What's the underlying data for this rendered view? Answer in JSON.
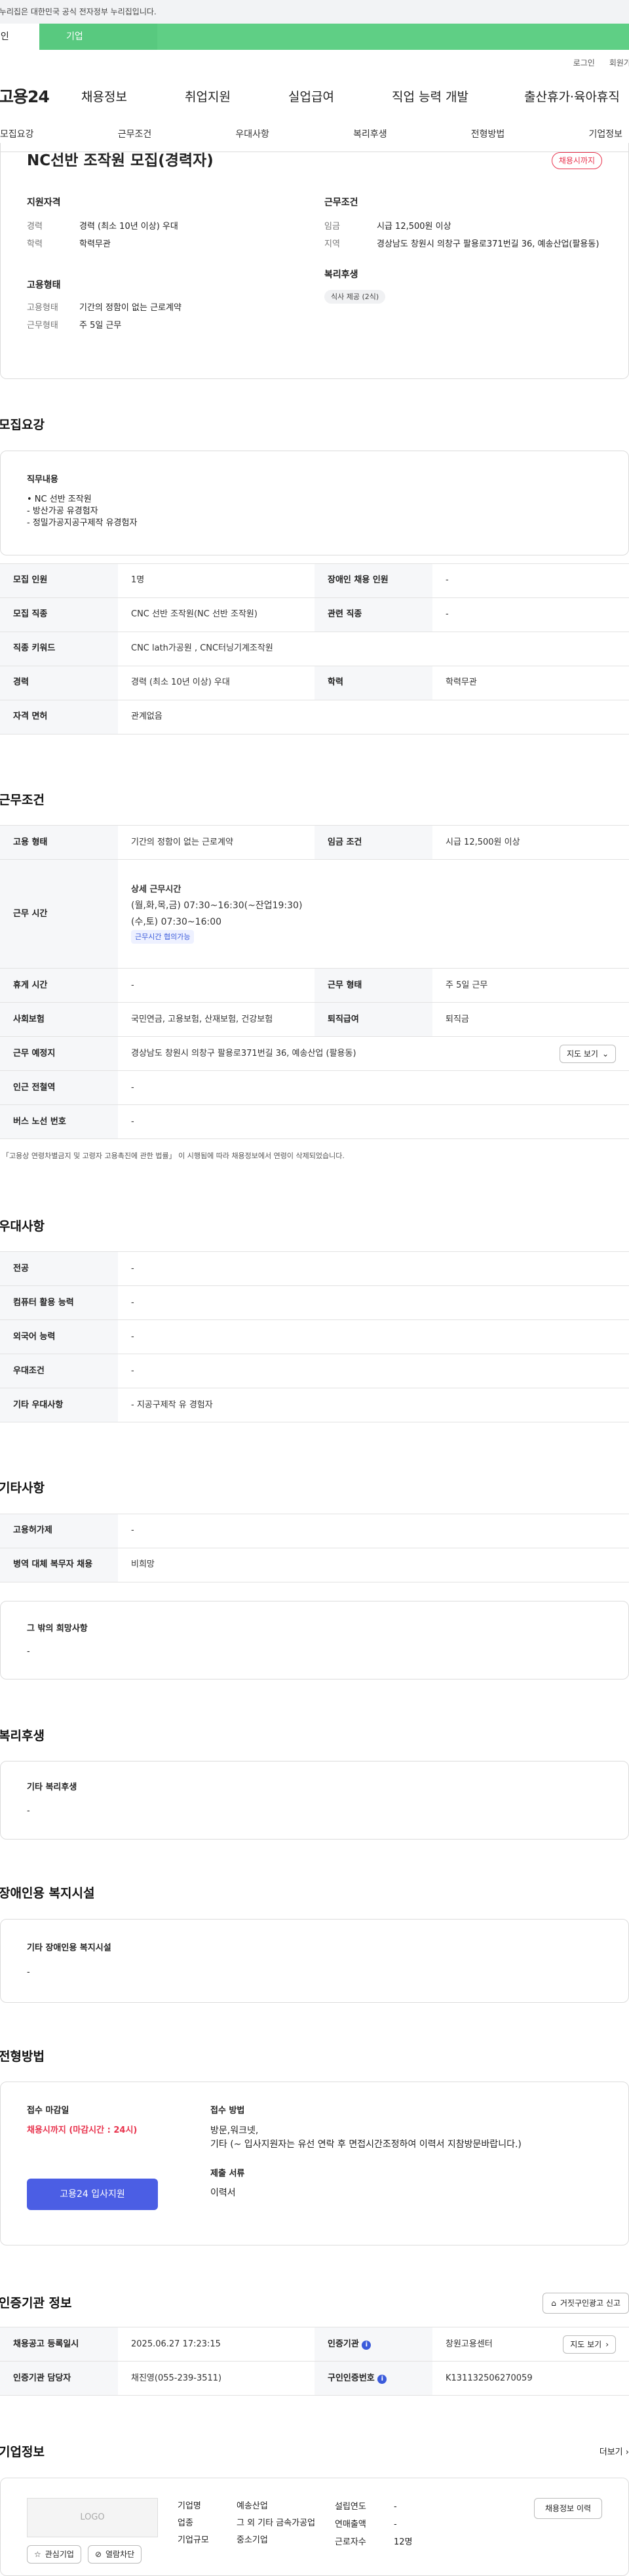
{
  "gov_banner": "이 누리집은 대한민국 공식 전자정부 누리집입니다.",
  "tabs": {
    "personal": "개인",
    "biz": "기업"
  },
  "util": {
    "login": "로그인",
    "join": "회원가입"
  },
  "gnb": {
    "logo": "고용24",
    "items": [
      "채용정보",
      "취업지원",
      "실업급여",
      "직업 능력 개발",
      "출산휴가·육아휴직"
    ]
  },
  "lnb": [
    "모집요강",
    "근무조건",
    "우대사항",
    "복리후생",
    "전형방법",
    "기업정보"
  ],
  "job": {
    "title": "NC선반 조작원 모집(경력자)",
    "badge": "채용시까지",
    "qual_title": "지원자격",
    "career_k": "경력",
    "career_v": "경력 (최소 10년 이상) 우대",
    "edu_k": "학력",
    "edu_v": "학력무관",
    "type_title": "고용형태",
    "emp_k": "고용형태",
    "emp_v": "기간의 정함이 없는 근로계약",
    "work_k": "근무형태",
    "work_v": "주 5일 근무",
    "cond_title": "근무조건",
    "wage_k": "임금",
    "wage_v": "시급 12,500원 이상",
    "area_k": "지역",
    "area_v": "경상남도 창원시 의창구 팔용로371번길 36, 예송산업(팔용동)",
    "welfare_title": "복리후생",
    "welfare_v": "식사 제공 (2식)"
  },
  "recruit": {
    "title": "모집요강",
    "duty_title": "직무내용",
    "duty_lines": [
      "• NC 선반 조작원",
      "- 방산가공 유경험자",
      "- 정밀가공지공구제작 유경험자"
    ],
    "rows": [
      [
        "모집 인원",
        "1명",
        "장애인 채용 인원",
        "-"
      ],
      [
        "모집 직종",
        "CNC 선반 조작원(NC 선반 조작원)",
        "관련 직종",
        "-"
      ],
      [
        "직종 키워드",
        "CNC lath가공원 , CNC터닝기계조작원"
      ],
      [
        "경력",
        "경력 (최소 10년 이상) 우대",
        "학력",
        "학력무관"
      ],
      [
        "자격 면허",
        "관계없음"
      ]
    ]
  },
  "cond": {
    "title": "근무조건",
    "r1": [
      "고용 형태",
      "기간의 정함이 없는 근로계약",
      "임금 조건",
      "시급 12,500원 이상"
    ],
    "time_k": "근무 시간",
    "time_head": "상세 근무시간",
    "time_l1": "(월,화,목,금) 07:30~16:30(~잔업19:30)",
    "time_l2": "(수,토) 07:30~16:00",
    "time_tag": "근무시간 협의가능",
    "r3": [
      "휴게 시간",
      "-",
      "근무 형태",
      "주 5일 근무"
    ],
    "r4": [
      "사회보험",
      "국민연금, 고용보험, 산재보험, 건강보험",
      "퇴직급여",
      "퇴직금"
    ],
    "addr_k": "근무 예정지",
    "addr_v": "경상남도 창원시 의창구 팔용로371번길 36, 예송산업 (팔용동)",
    "map_btn": "지도 보기",
    "r6": [
      "인근 전철역",
      "-"
    ],
    "r7": [
      "버스 노선 번호",
      "-"
    ],
    "note": "* 「고용상 연령차별금지 및 고령자 고용촉진에 관한 법률」 이 시행됨에 따라 채용정보에서 연령이 삭제되었습니다."
  },
  "pref": {
    "title": "우대사항",
    "rows": [
      [
        "전공",
        "-"
      ],
      [
        "컴퓨터 활용 능력",
        "-"
      ],
      [
        "외국어 능력",
        "-"
      ],
      [
        "우대조건",
        "-"
      ],
      [
        "기타 우대사항",
        "- 지공구제작 유 경험자"
      ]
    ]
  },
  "etc": {
    "title": "기타사항",
    "rows": [
      [
        "고용허가제",
        "-"
      ],
      [
        "병역 대체 복무자 채용",
        "비희망"
      ]
    ],
    "hope_title": "그 밖의 희망사항",
    "hope_v": "-"
  },
  "welfare": {
    "title": "복리후생",
    "box_title": "기타 복리후생",
    "box_v": "-"
  },
  "disab": {
    "title": "장애인용 복지시설",
    "box_title": "기타 장애인용 복지시설",
    "box_v": "-"
  },
  "selection": {
    "title": "전형방법",
    "deadline_title": "접수 마감일",
    "deadline_v": "채용시까지 (마감시간 : 24시)",
    "apply_btn": "고용24 입사지원",
    "method_title": "접수 방법",
    "method_l1": "방문,워크넷,",
    "method_l2": "기타 (~ 입사지원자는 유선 연락 후 면접시간조정하여 이력서 지참방문바랍니다.)",
    "docs_title": "제출 서류",
    "docs_v": "이력서"
  },
  "cert": {
    "title": "인증기관 정보",
    "report_btn": "거짓구인광고 신고",
    "reg_k": "채용공고 등록일시",
    "reg_v": "2025.06.27 17:23:15",
    "agency_k": "인증기관",
    "agency_v": "창원고용센터",
    "detail_btn": "지도 보기",
    "mgr_k": "인증기관 담당자",
    "mgr_v": "채진영(055-239-3511)",
    "num_k": "구인인증번호",
    "num_v": "K131132506270059"
  },
  "company": {
    "title": "기업정보",
    "more": "더보기",
    "logo": "LOGO",
    "fav_btn": "관심기업",
    "block_btn": "열람차단",
    "name_k": "기업명",
    "name_v": "예송산업",
    "ind_k": "업종",
    "ind_v": "그 외 기타 금속가공업",
    "size_k": "기업규모",
    "size_v": "중소기업",
    "year_k": "설립연도",
    "year_v": "-",
    "sales_k": "연매출액",
    "sales_v": "-",
    "emp_k": "근로자수",
    "emp_v": "12명",
    "list_btn": "채용정보 이력"
  }
}
